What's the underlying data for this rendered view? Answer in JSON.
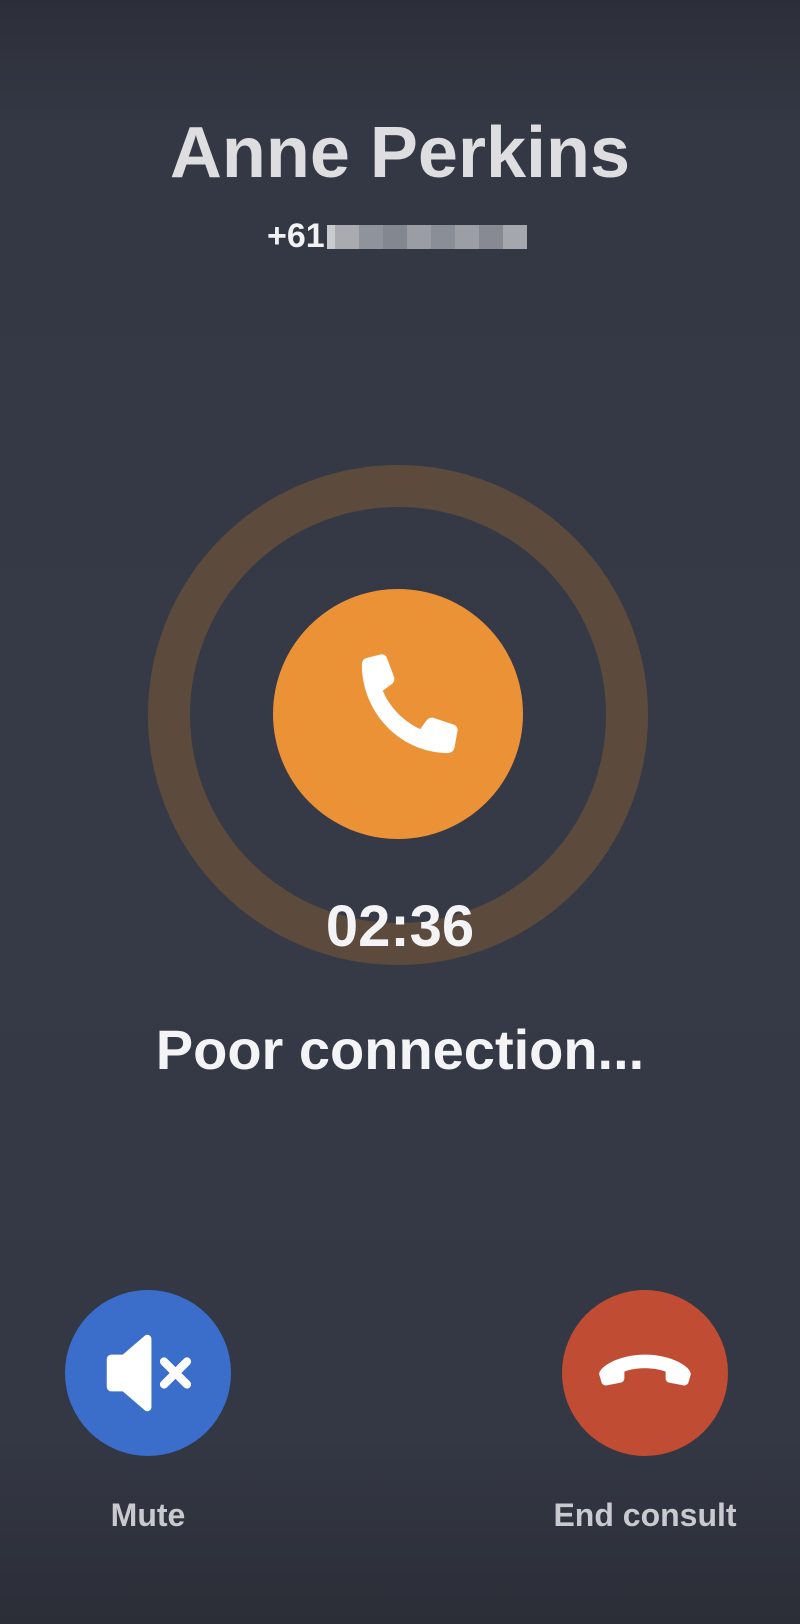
{
  "caller": {
    "name": "Anne Perkins",
    "number_prefix": "+61"
  },
  "call": {
    "timer": "02:36",
    "status": "Poor connection..."
  },
  "actions": {
    "mute_label": "Mute",
    "end_label": "End consult"
  },
  "colors": {
    "background": "#363a46",
    "accent_orange": "#ec9236",
    "ring_brown": "#5c4b3c",
    "mute_blue": "#3b6ecb",
    "end_red": "#c04d33"
  },
  "icons": {
    "call_status": "phone-icon",
    "mute": "speaker-muted-icon",
    "end": "hang-up-icon"
  }
}
